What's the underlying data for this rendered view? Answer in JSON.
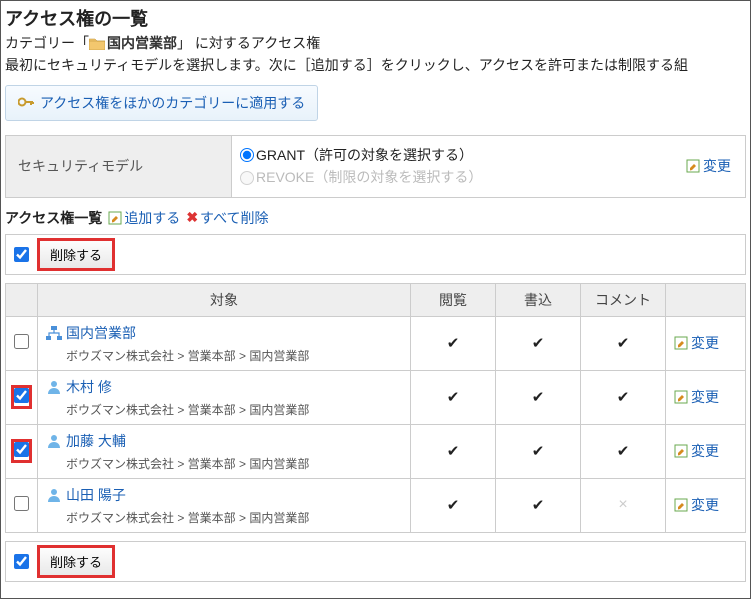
{
  "title": "アクセス権の一覧",
  "category_prefix": "カテゴリー「",
  "category_name": "国内営業部",
  "category_suffix": "」 に対するアクセス権",
  "desc": "最初にセキュリティモデルを選択します。次に［追加する］をクリックし、アクセスを許可または制限する組",
  "apply_btn": "アクセス権をほかのカテゴリーに適用する",
  "sec_model": {
    "label": "セキュリティモデル",
    "grant": "GRANT（許可の対象を選択する）",
    "revoke": "REVOKE（制限の対象を選択する）",
    "change": "変更"
  },
  "list": {
    "title": "アクセス権一覧",
    "add": "追加する",
    "delete_all": "すべて削除",
    "delete_btn": "削除する",
    "headers": {
      "target": "対象",
      "view": "閲覧",
      "write": "書込",
      "comment": "コメント"
    },
    "change": "変更",
    "rows": [
      {
        "type": "org",
        "name": "国内営業部",
        "path": "ボウズマン株式会社 > 営業本部 > 国内営業部",
        "checked": false,
        "view": true,
        "write": true,
        "comment": true
      },
      {
        "type": "user",
        "name": "木村 修",
        "path": "ボウズマン株式会社 > 営業本部 > 国内営業部",
        "checked": true,
        "view": true,
        "write": true,
        "comment": true
      },
      {
        "type": "user",
        "name": "加藤 大輔",
        "path": "ボウズマン株式会社 > 営業本部 > 国内営業部",
        "checked": true,
        "view": true,
        "write": true,
        "comment": true
      },
      {
        "type": "user",
        "name": "山田 陽子",
        "path": "ボウズマン株式会社 > 営業本部 > 国内営業部",
        "checked": false,
        "view": true,
        "write": true,
        "comment": false
      }
    ]
  }
}
